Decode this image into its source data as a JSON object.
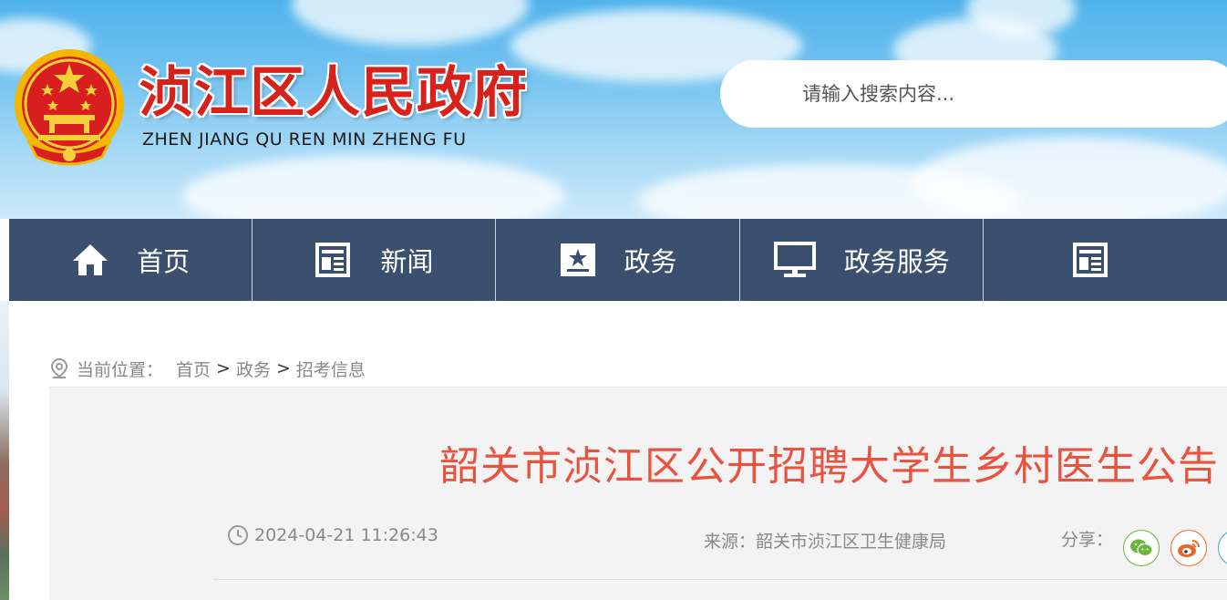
{
  "header": {
    "site_title": "浈江区人民政府",
    "site_pinyin": "ZHEN JIANG QU REN MIN ZHENG FU",
    "emblem_icon": "national-emblem-icon"
  },
  "search": {
    "placeholder": "请输入搜索内容..."
  },
  "nav": {
    "items": [
      {
        "label": "首页",
        "icon": "home-icon"
      },
      {
        "label": "新闻",
        "icon": "newspaper-icon"
      },
      {
        "label": "政务",
        "icon": "government-affairs-icon"
      },
      {
        "label": "政务服务",
        "icon": "monitor-icon"
      },
      {
        "label": "",
        "icon": "newspaper-icon"
      }
    ]
  },
  "breadcrumb": {
    "prefix": "当前位置：",
    "items": [
      "首页",
      "政务",
      "招考信息"
    ],
    "separator": ">"
  },
  "article": {
    "title": "韶关市浈江区公开招聘大学生乡村医生公告",
    "date": "2024-04-21 11:26:43",
    "source": "来源：韶关市浈江区卫生健康局",
    "share_label": "分享："
  },
  "colors": {
    "nav_bg": "#3b506e",
    "title_red": "#e8523f",
    "brand_red": "#d7221c",
    "wechat_green": "#6ab63a",
    "weibo_orange": "#e86a2b",
    "qq_blue": "#3ea8dc"
  }
}
